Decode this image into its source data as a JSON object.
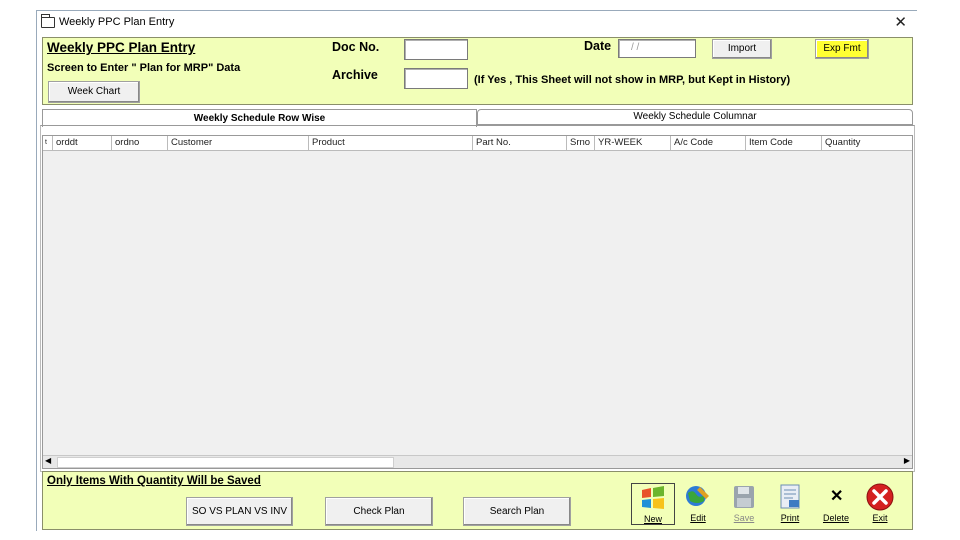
{
  "window": {
    "title": "Weekly PPC Plan Entry",
    "close_glyph": "✕"
  },
  "header": {
    "title": "Weekly PPC Plan Entry",
    "subtitle": "Screen to Enter \" Plan for MRP\" Data",
    "week_chart_label": "Week Chart",
    "doc_no_label": "Doc No.",
    "doc_no_value": "",
    "archive_label": "Archive",
    "archive_value": "",
    "date_label": "Date",
    "date_value": "/  /",
    "import_label": "Import",
    "exp_fmt_label": "Exp Fmt",
    "archive_note": "(If Yes , This Sheet will not show in MRP, but Kept in History)"
  },
  "tabs": [
    {
      "label": "Weekly Schedule Row Wise",
      "active": true
    },
    {
      "label": "Weekly Schedule Columnar",
      "active": false
    }
  ],
  "grid": {
    "columns": [
      "t",
      "orddt",
      "ordno",
      "Customer",
      "Product",
      "Part No.",
      "Srno",
      "YR-WEEK",
      "A/c Code",
      "Item Code",
      "Quantity"
    ],
    "rows": []
  },
  "footer": {
    "note": "Only Items With Quantity Will be Saved",
    "so_vs_plan_label": "SO VS PLAN VS INV",
    "check_plan_label": "Check Plan",
    "search_plan_label": "Search Plan"
  },
  "toolbar": [
    {
      "label": "New",
      "icon": "windows-logo-icon"
    },
    {
      "label": "Edit",
      "icon": "globe-edit-icon"
    },
    {
      "label": "Save",
      "icon": "floppy-disk-icon"
    },
    {
      "label": "Print",
      "icon": "print-document-icon"
    },
    {
      "label": "Delete",
      "icon": "delete-x-icon"
    },
    {
      "label": "Exit",
      "icon": "exit-icon"
    }
  ],
  "colors": {
    "panel_bg": "#f2ffb8",
    "exp_fmt_bg": "#ffff33",
    "exit_red": "#d42020"
  }
}
